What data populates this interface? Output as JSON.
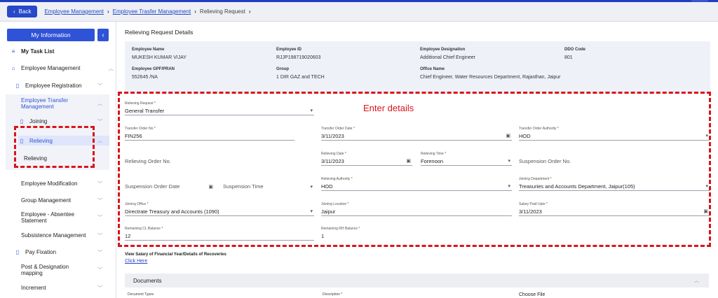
{
  "header": {
    "back_label": "Back",
    "breadcrumb": [
      "Employee Management",
      "Employee Trasfer Management",
      "Relieving Request"
    ]
  },
  "sidebar": {
    "my_information": "My Information",
    "items": [
      {
        "label": "My Task List",
        "icon": "list-icon"
      },
      {
        "label": "Employee Management",
        "icon": "building-icon"
      },
      {
        "label": "Employee Registration",
        "icon": "document-icon"
      },
      {
        "label": "Employee Transfer Management",
        "icon": ""
      },
      {
        "label": "Joining",
        "icon": "document-icon"
      },
      {
        "label": "Relieving",
        "icon": "document-icon"
      },
      {
        "label": "Relieving",
        "icon": ""
      },
      {
        "label": "Employee Modification",
        "icon": ""
      },
      {
        "label": "Group Management",
        "icon": ""
      },
      {
        "label": "Employee - Absentee Statement",
        "icon": ""
      },
      {
        "label": "Subsistence Management",
        "icon": ""
      },
      {
        "label": "Pay Fixation",
        "icon": "document-icon"
      },
      {
        "label": "Post & Designation mapping",
        "icon": ""
      },
      {
        "label": "Increment",
        "icon": ""
      }
    ]
  },
  "main": {
    "title": "Relieving Request Details",
    "employee_info": {
      "name_label": "Employee Name",
      "name_value": "MUKESH KUMAR VIJAY",
      "id_label": "Employee ID",
      "id_value": "RJJP198719020603",
      "designation_label": "Employee Designation",
      "designation_value": "Additional Chief Engineer",
      "ddo_label": "DDO Code",
      "ddo_value": "801",
      "gpf_label": "Employee GPF/PRAN",
      "gpf_value": "552645 /NA",
      "group_label": "Group",
      "group_value": "1 DIR GAZ and TECH",
      "office_label": "Office Name",
      "office_value": "Chief Engineer, Water Resources Department, Rajasthan, Jaipur"
    },
    "annotation": "Enter details",
    "form": {
      "relieving_request_label": "Relieving Request *",
      "relieving_request_value": "General Transfer",
      "transfer_order_no_label": "Transfer Order No *",
      "transfer_order_no_value": "FIN256",
      "transfer_order_date_label": "Transfer Order Date *",
      "transfer_order_date_value": "3/11/2023",
      "transfer_order_authority_label": "Transfer Order Authority *",
      "transfer_order_authority_value": "HOD",
      "relieving_order_no_placeholder": "Relieving Order No.",
      "relieving_date_label": "Relieving Date *",
      "relieving_date_value": "3/11/2023",
      "relieving_time_label": "Relieving Time *",
      "relieving_time_value": "Forenoon",
      "suspension_order_no_placeholder": "Suspension Order No.",
      "suspension_order_date_placeholder": "Suspension Order Date",
      "suspension_time_placeholder": "Suspension Time",
      "relieving_authority_label": "Relieving Authority *",
      "relieving_authority_value": "HOD",
      "joining_department_label": "Joining Department *",
      "joining_department_value": "Treasuries and Accounts Department, Jaipur(105)",
      "joining_office_label": "Joining Office *",
      "joining_office_value": "Directrate Treasury and Accounts (1090)",
      "joining_location_label": "Joining Location *",
      "joining_location_value": "Jaipur",
      "salary_paid_upto_label": "Salary Paid Upto *",
      "salary_paid_upto_value": "3/11/2023",
      "remaining_cl_label": "Remaining CL Balance *",
      "remaining_cl_value": "12",
      "remaining_rh_label": "Remaining RH Balance *",
      "remaining_rh_value": "1"
    },
    "salary_text": "View Salary of Financial Year/Details of Recoveries",
    "click_here": "Click Here",
    "documents": {
      "title": "Documents",
      "col_types": "Document Types",
      "col_description": "Description *",
      "choose_file": "Choose File"
    }
  },
  "colors": {
    "accent": "#2f53d6",
    "annotation": "#d9141b"
  }
}
